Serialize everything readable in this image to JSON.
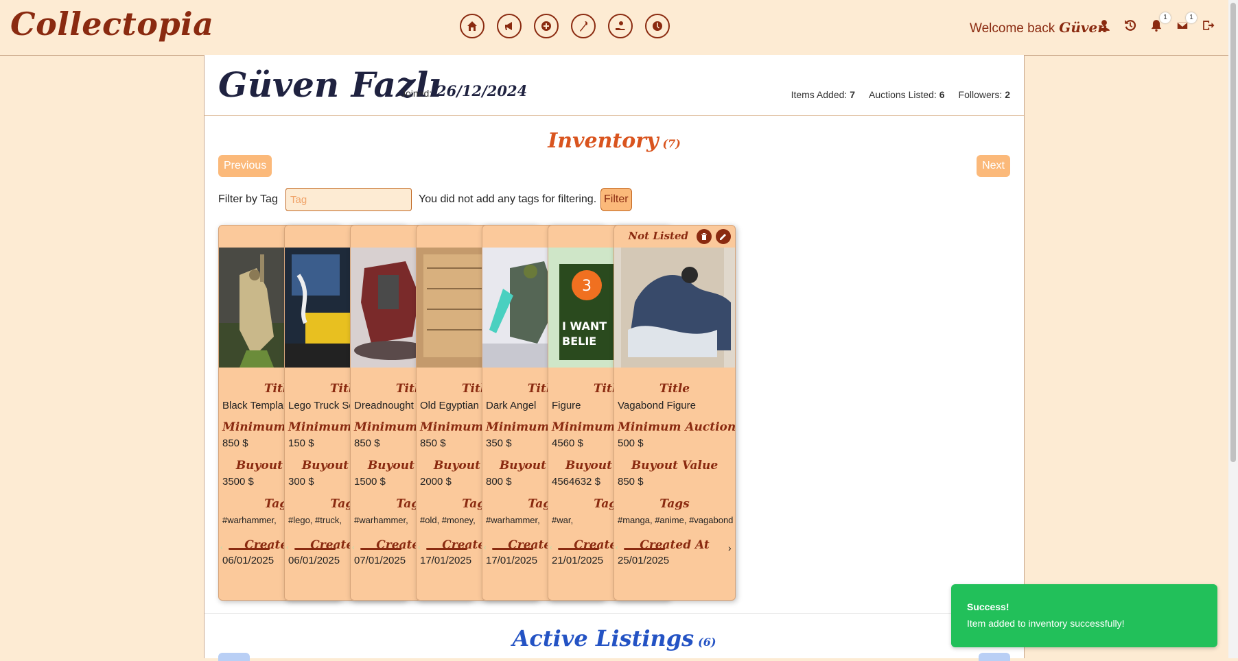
{
  "header": {
    "logo": "Collectopia",
    "welcome_text": "Welcome back",
    "username": "Güven",
    "nav_icons": [
      "home-icon",
      "megaphone-icon",
      "plus-circle-icon",
      "wand-icon",
      "hand-coin-icon",
      "auction-clock-icon"
    ],
    "notification_count": "1",
    "message_count": "1"
  },
  "profile": {
    "name": "Güven Fazlı",
    "joined_label": "Joined:",
    "joined_date": "26/12/2024",
    "items_added_label": "Items Added:",
    "items_added": "7",
    "auctions_listed_label": "Auctions Listed:",
    "auctions_listed": "6",
    "followers_label": "Followers:",
    "followers": "2"
  },
  "inventory": {
    "title": "Inventory",
    "count": "(7)",
    "previous_label": "Previous",
    "next_label": "Next",
    "filter_label": "Filter by Tag",
    "tag_placeholder": "Tag",
    "no_tags_text": "You did not add any tags for filtering.",
    "filter_button": "Filter",
    "labels": {
      "title": "Title",
      "min": "Minimum Auction Value",
      "buyout": "Buyout Value",
      "tags": "Tags",
      "created": "Created At"
    },
    "status_label": "Not Listed",
    "items": [
      {
        "title": "Black Templar",
        "min": "850 $",
        "buyout": "3500 $",
        "tags": "#warhammer,",
        "created": "06/01/2025"
      },
      {
        "title": "Lego Truck Set",
        "min": "150 $",
        "buyout": "300 $",
        "tags": "#lego, #truck,",
        "created": "06/01/2025"
      },
      {
        "title": "Dreadnought",
        "min": "850 $",
        "buyout": "1500 $",
        "tags": "#warhammer,",
        "created": "07/01/2025"
      },
      {
        "title": "Old Egyptian",
        "min": "850 $",
        "buyout": "2000 $",
        "tags": "#old, #money,",
        "created": "17/01/2025"
      },
      {
        "title": "Dark Angel",
        "min": "350 $",
        "buyout": "800 $",
        "tags": "#warhammer,",
        "created": "17/01/2025"
      },
      {
        "title": "Figure",
        "min": "4560 $",
        "buyout": "4564632 $",
        "tags": "#war,",
        "created": "21/01/2025"
      },
      {
        "title": "Vagabond Figure",
        "min": "500 $",
        "buyout": "850 $",
        "tags": "#manga, #anime, #vagabond",
        "created": "25/01/2025"
      }
    ]
  },
  "active_listings": {
    "title": "Active Listings",
    "count": "(6)"
  },
  "toast": {
    "title": "Success!",
    "message": "Item added to inventory successfully!"
  },
  "colors": {
    "brand": "#8a2a10",
    "background": "#fdebd3",
    "card": "#fbc99b",
    "inventory_title": "#d9541e",
    "listing_title": "#2453c4",
    "toast": "#22c05a"
  }
}
